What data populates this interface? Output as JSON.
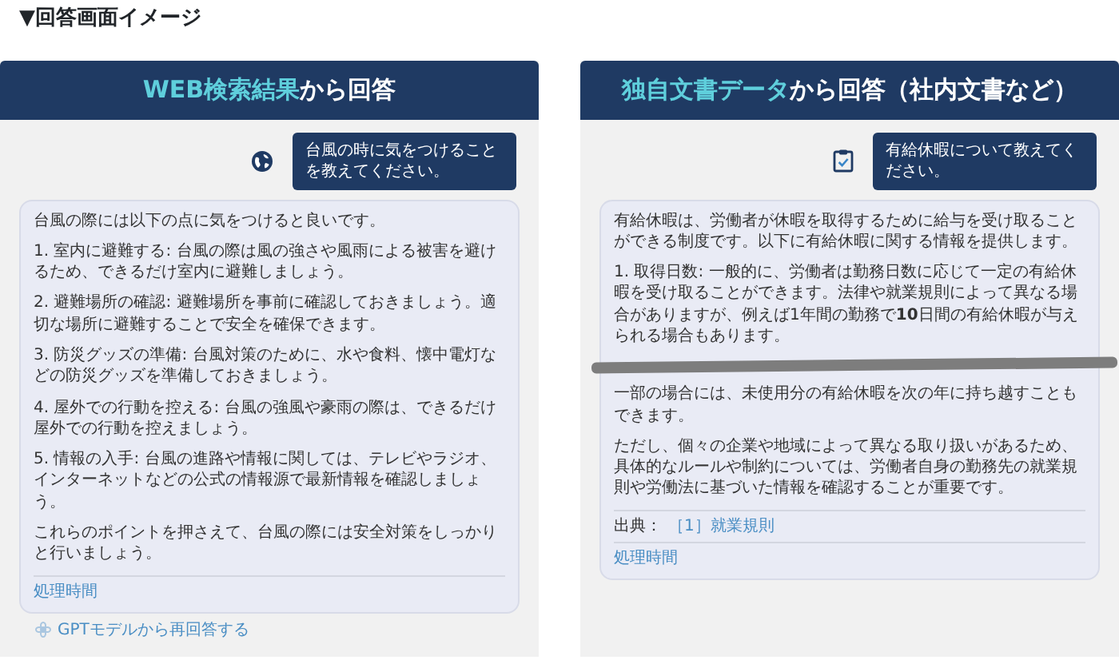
{
  "heading": "▼回答画面イメージ",
  "panels": [
    {
      "title": {
        "highlight": "WEB検索結果",
        "rest": "から回答"
      },
      "kind": "web",
      "question": "台風の時に気をつけることを教えてください。",
      "answer": [
        {
          "text": "台風の際には以下の点に気をつけると良いです。"
        },
        {
          "text": "1. 室内に避難する: 台風の際は風の強さや風雨による被害を避けるため、できるだけ室内に避難しましょう。"
        },
        {
          "text": "2. 避難場所の確認: 避難場所を事前に確認しておきましょう。適切な場所に避難することで安全を確保できます。"
        },
        {
          "text": "3. 防災グッズの準備: 台風対策のために、水や食料、懐中電灯などの防災グッズを準備しておきましょう。"
        },
        {
          "text": "4. 屋外での行動を控える: 台風の強風や豪雨の際は、できるだけ屋外での行動を控えましょう。"
        },
        {
          "text": "5. 情報の入手: 台風の進路や情報に関しては、テレビやラジオ、インターネットなどの公式の情報源で最新情報を確認しましょう。"
        },
        {
          "text": "これらのポイントを押さえて、台風の際には安全対策をしっかりと行いましょう。"
        }
      ],
      "processing_time": "処理時間",
      "retry": "GPTモデルから再回答する"
    },
    {
      "title": {
        "highlight": "独自文書データ",
        "rest": "から回答（社内文書など）"
      },
      "kind": "document",
      "question": "有給休暇について教えてください。",
      "answer": [
        {
          "text": "有給休暇は、労働者が休暇を取得するために給与を受け取ることができる制度です。以下に有給休暇に関する情報を提供します。"
        },
        {
          "text": "1. 取得日数: 一般的に、労働者は勤務日数に応じて一定の有給休暇を受け取ることができます。法律や就業規則によって異なる場合がありますが、例えば1年間の勤務で**10**日間の有給休暇が与えられる場合もあります。"
        },
        {
          "kind": "omission"
        },
        {
          "text": "一部の場合には、未使用分の有給休暇を次の年に持ち越すこともできます。"
        },
        {
          "text": "ただし、個々の企業や地域によって異なる取り扱いがあるため、具体的なルールや制約については、労働者自身の勤務先の就業規則や労働法に基づいた情報を確認することが重要です。"
        }
      ],
      "source": {
        "label": "出典：",
        "link": "［1］就業規則"
      },
      "processing_time": "処理時間"
    }
  ]
}
